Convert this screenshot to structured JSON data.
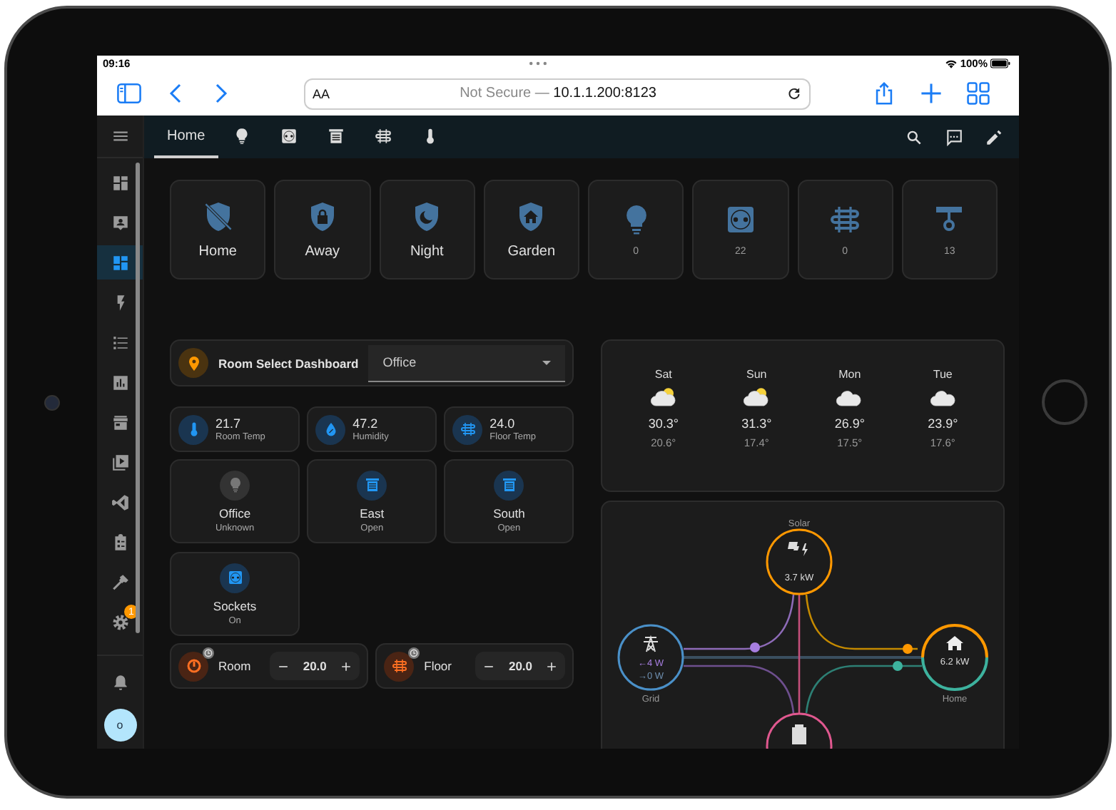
{
  "status_bar": {
    "time": "09:16",
    "battery": "100%"
  },
  "browser": {
    "text_size": "AA",
    "security": "Not Secure —",
    "url": "10.1.1.200:8123"
  },
  "sidebar": {
    "items": [
      {
        "kind": "overview",
        "selected": false
      },
      {
        "kind": "account",
        "selected": false
      },
      {
        "kind": "dashboard",
        "selected": true
      },
      {
        "kind": "flash",
        "selected": false
      },
      {
        "kind": "list",
        "selected": false
      },
      {
        "kind": "chart",
        "selected": false
      },
      {
        "kind": "store",
        "selected": false
      },
      {
        "kind": "media",
        "selected": false
      },
      {
        "kind": "code",
        "selected": false
      },
      {
        "kind": "clipboard",
        "selected": false
      },
      {
        "kind": "hammer",
        "selected": false
      },
      {
        "kind": "settings",
        "selected": false,
        "badge": "1"
      }
    ],
    "avatar": "o"
  },
  "header": {
    "tabs": [
      {
        "kind": "text",
        "label": "Home",
        "selected": true
      },
      {
        "kind": "bulb",
        "selected": false
      },
      {
        "kind": "socket",
        "selected": false
      },
      {
        "kind": "shutter",
        "selected": false
      },
      {
        "kind": "radiator",
        "selected": false
      },
      {
        "kind": "thermometer",
        "selected": false
      }
    ]
  },
  "scenes": [
    {
      "kind": "shield-off",
      "name": "Home"
    },
    {
      "kind": "shield-lock",
      "name": "Away"
    },
    {
      "kind": "shield-moon",
      "name": "Night"
    },
    {
      "kind": "shield-home",
      "name": "Garden"
    }
  ],
  "counters": [
    {
      "kind": "bulb",
      "count": "0"
    },
    {
      "kind": "socket",
      "count": "22"
    },
    {
      "kind": "radiator",
      "count": "0"
    },
    {
      "kind": "lamp",
      "count": "13"
    }
  ],
  "room_select": {
    "title": "Room Select Dashboard",
    "value": "Office"
  },
  "sensors": [
    {
      "kind": "thermometer",
      "value": "21.7",
      "label": "Room Temp"
    },
    {
      "kind": "drop",
      "value": "47.2",
      "label": "Humidity"
    },
    {
      "kind": "radiator",
      "value": "24.0",
      "label": "Floor Temp"
    }
  ],
  "entities": [
    {
      "kind": "bulb",
      "name": "Office",
      "state": "Unknown",
      "active": false
    },
    {
      "kind": "shutter",
      "name": "East",
      "state": "Open",
      "active": true
    },
    {
      "kind": "shutter",
      "name": "South",
      "state": "Open",
      "active": true
    },
    {
      "kind": "socket",
      "name": "Sockets",
      "state": "On",
      "active": true
    }
  ],
  "thermostats": [
    {
      "kind": "knob",
      "name": "Room",
      "value": "20.0"
    },
    {
      "kind": "radiator",
      "name": "Floor",
      "value": "20.0"
    }
  ],
  "forecast": [
    {
      "kind": "partly-sunny",
      "day": "Sat",
      "high": "30.3°",
      "low": "20.6°"
    },
    {
      "kind": "partly-sunny",
      "day": "Sun",
      "high": "31.3°",
      "low": "17.4°"
    },
    {
      "kind": "cloudy",
      "day": "Mon",
      "high": "26.9°",
      "low": "17.5°"
    },
    {
      "kind": "cloudy",
      "day": "Tue",
      "high": "23.9°",
      "low": "17.6°"
    }
  ],
  "energy": {
    "solar_label": "Solar",
    "solar_power": "3.7 kW",
    "grid_label": "Grid",
    "grid_import": "←4 W",
    "grid_export": "→0 W",
    "home_label": "Home",
    "home_power": "6.2 kW"
  }
}
